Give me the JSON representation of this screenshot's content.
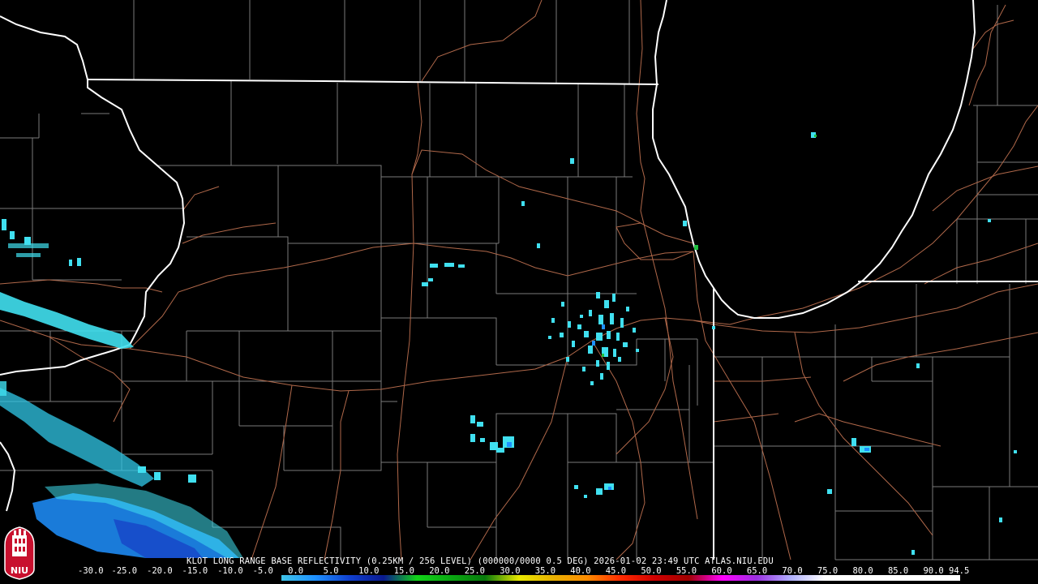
{
  "header": {
    "caption": "KLOT LONG RANGE BASE REFLECTIVITY (0.25KM / 256 LEVEL) (000000/0000 0.5 DEG) 2026-01-02 23:49 UTC  ATLAS.NIU.EDU"
  },
  "logo": {
    "text": "NIU",
    "colors": {
      "background": "#c8102e",
      "tower": "#ffffff"
    }
  },
  "color_scale": {
    "labels": [
      "-30.0",
      "-25.0",
      "-20.0",
      "-15.0",
      "-10.0",
      "-5.0",
      "0.0",
      "5.0",
      "10.0",
      "15.0",
      "20.0",
      "25.0",
      "30.0",
      "35.0",
      "40.0",
      "45.0",
      "50.0",
      "55.0",
      "60.0",
      "65.0",
      "70.0",
      "75.0",
      "80.0",
      "85.0",
      "90.0",
      "94.5"
    ],
    "colors": [
      "#000000",
      "#000000",
      "#000000",
      "#000000",
      "#000000",
      "#000000",
      "#3fc4e8",
      "#1e90ff",
      "#1040d0",
      "#0a1a90",
      "#12d418",
      "#0aa812",
      "#087a0c",
      "#e8e800",
      "#e8b000",
      "#ff8c00",
      "#ff2a00",
      "#d00000",
      "#a00000",
      "#ff00ff",
      "#9a30e0",
      "#b0b0ff",
      "#ffffff",
      "#ffffff",
      "#ffffff",
      "#ffffff"
    ]
  },
  "map_colors": {
    "background": "#000000",
    "state_border": "#ffffff",
    "county_border": "#7a7a7a",
    "highway": "#b0684a",
    "echo_light": "#40e0f0",
    "echo_medium": "#1e90ff",
    "echo_strong": "#1848c8",
    "echo_green": "#20c040"
  }
}
